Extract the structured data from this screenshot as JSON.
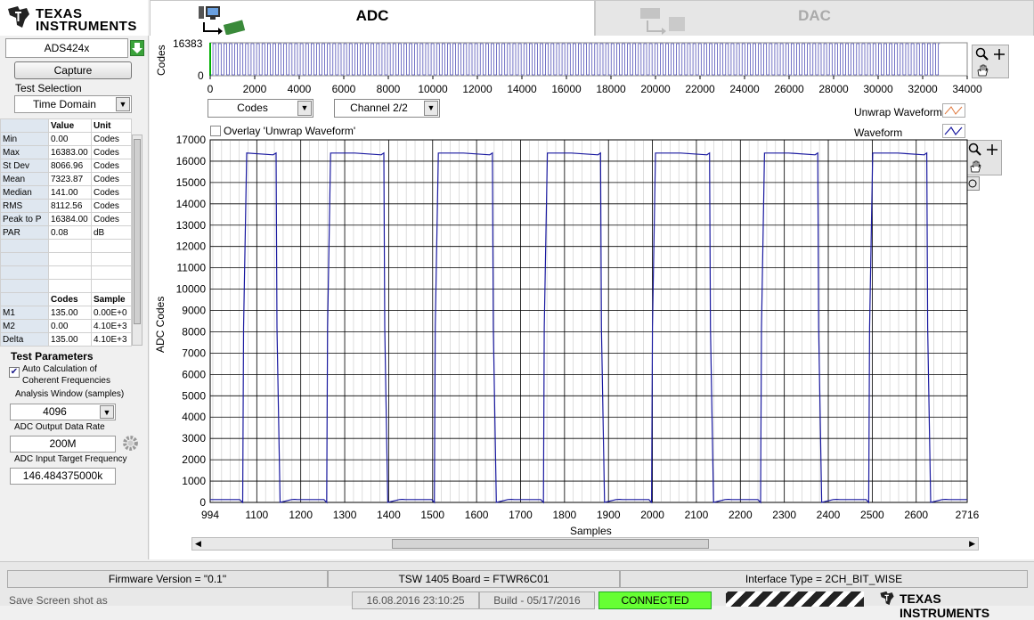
{
  "brand": {
    "line1": "Texas",
    "line2": "Instruments",
    "footer": "Texas Instruments"
  },
  "tabs": [
    {
      "label": "ADC"
    },
    {
      "label": "DAC"
    }
  ],
  "left": {
    "device": "ADS424x",
    "capture_label": "Capture",
    "test_selection_label": "Test Selection",
    "test_selection_value": "Time Domain",
    "stats_headers": [
      "Value",
      "Unit"
    ],
    "stats": [
      {
        "name": "Min",
        "value": "0.00",
        "unit": "Codes"
      },
      {
        "name": "Max",
        "value": "16383.00",
        "unit": "Codes"
      },
      {
        "name": "St Dev",
        "value": "8066.96",
        "unit": "Codes"
      },
      {
        "name": "Mean",
        "value": "7323.87",
        "unit": "Codes"
      },
      {
        "name": "Median",
        "value": "141.00",
        "unit": "Codes"
      },
      {
        "name": "RMS",
        "value": "8112.56",
        "unit": "Codes"
      },
      {
        "name": "Peak to P",
        "value": "16384.00",
        "unit": "Codes"
      },
      {
        "name": "PAR",
        "value": "0.08",
        "unit": "dB"
      }
    ],
    "marker_headers": [
      "Codes",
      "Sample"
    ],
    "markers": [
      {
        "name": "M1",
        "codes": "135.00",
        "sample": "0.00E+0"
      },
      {
        "name": "M2",
        "codes": "0.00",
        "sample": "4.10E+3"
      },
      {
        "name": "Delta",
        "codes": "135.00",
        "sample": "4.10E+3"
      }
    ],
    "test_params_title": "Test Parameters",
    "auto_calc_label1": "Auto Calculation of",
    "auto_calc_label2": "Coherent Frequencies",
    "auto_calc_checked": true,
    "analysis_window_label": "Analysis Window (samples)",
    "analysis_window_value": "4096",
    "data_rate_label": "ADC Output Data Rate",
    "data_rate_value": "200M",
    "target_freq_label": "ADC Input Target Frequency",
    "target_freq_value": "146.484375000k"
  },
  "overview": {
    "ylabel": "Codes",
    "ymax_label": "16383",
    "ymin_label": "0",
    "xticks": [
      "0",
      "2000",
      "4000",
      "6000",
      "8000",
      "10000",
      "12000",
      "14000",
      "16000",
      "18000",
      "20000",
      "22000",
      "24000",
      "26000",
      "28000",
      "30000",
      "32000",
      "34000"
    ]
  },
  "controls": {
    "units_value": "Codes",
    "channel_value": "Channel 2/2",
    "overlay_label": "Overlay 'Unwrap Waveform'",
    "legend_unwrap": "Unwrap Waveform",
    "legend_waveform": "Waveform"
  },
  "chart_data": {
    "type": "line",
    "xlabel": "Samples",
    "ylabel": "ADC Codes",
    "xlim": [
      994,
      2716
    ],
    "ylim": [
      0,
      17000
    ],
    "yticks": [
      "0",
      "1000",
      "2000",
      "3000",
      "4000",
      "5000",
      "6000",
      "7000",
      "8000",
      "9000",
      "10000",
      "11000",
      "12000",
      "13000",
      "14000",
      "15000",
      "16000",
      "17000"
    ],
    "xticks": [
      "994",
      "1100",
      "1200",
      "1300",
      "1400",
      "1500",
      "1600",
      "1700",
      "1800",
      "1900",
      "2000",
      "2100",
      "2200",
      "2300",
      "2400",
      "2500",
      "2600",
      "2716"
    ],
    "series": [
      {
        "color": "#1a1aa0",
        "x": [
          994,
          1061,
          1068,
          1070,
          1077,
          1137,
          1144,
          1146,
          1153,
          1179,
          1185,
          1187,
          1193,
          1253,
          1259,
          1261,
          1268,
          1308,
          1315,
          1317,
          1323,
          1383,
          1389,
          1391,
          1398,
          1424,
          1430,
          1432,
          1438,
          1498,
          1504,
          1506,
          1513,
          1555,
          1562,
          1564,
          1570,
          1630,
          1636,
          1638,
          1645,
          1671,
          1678,
          1680,
          1686,
          1746,
          1752,
          1754,
          1761,
          1801,
          1808,
          1810,
          1816,
          1876,
          1882,
          1884,
          1891,
          1917,
          1924,
          1926,
          1932,
          1992,
          1998,
          2000,
          2007,
          2049,
          2056,
          2058,
          2064,
          2124,
          2130,
          2132,
          2139,
          2165,
          2172,
          2174,
          2180,
          2240,
          2246,
          2248,
          2255,
          2295,
          2302,
          2304,
          2310,
          2370,
          2376,
          2378,
          2385,
          2411,
          2418,
          2420,
          2426,
          2486,
          2492,
          2494,
          2501,
          2543,
          2550,
          2552,
          2558,
          2618,
          2624,
          2626,
          2633,
          2659,
          2666,
          2668,
          2674,
          2716
        ],
        "y": [
          135,
          135,
          0,
          8192,
          16383,
          16300,
          16383,
          8192,
          0,
          135,
          141,
          141,
          135,
          135,
          0,
          8192,
          16383,
          16383,
          16383,
          16383,
          16383,
          16300,
          16383,
          8192,
          0,
          135,
          141,
          141,
          135,
          135,
          0,
          8192,
          16383,
          16383,
          16383,
          16383,
          16383,
          16300,
          16383,
          8192,
          0,
          135,
          141,
          141,
          135,
          135,
          0,
          8192,
          16383,
          16383,
          16383,
          16383,
          16383,
          16300,
          16383,
          8192,
          0,
          135,
          141,
          141,
          135,
          135,
          0,
          8192,
          16383,
          16383,
          16383,
          16383,
          16383,
          16300,
          16383,
          8192,
          0,
          135,
          141,
          141,
          135,
          135,
          0,
          8192,
          16383,
          16383,
          16383,
          16383,
          16383,
          16300,
          16383,
          8192,
          0,
          135,
          141,
          141,
          135,
          135,
          0,
          8192,
          16383,
          16383,
          16383,
          16383,
          16383,
          16300,
          16383,
          8192,
          0,
          135,
          141,
          141,
          135,
          135
        ]
      }
    ],
    "grid": true
  },
  "status": {
    "firmware": "Firmware Version = \"0.1\"",
    "board": "TSW 1405 Board = FTWR6C01",
    "interface": "Interface Type = 2CH_BIT_WISE",
    "save_label": "Save Screen shot as",
    "datetime": "16.08.2016 23:10:25",
    "build": "Build  - 05/17/2016",
    "connection": "CONNECTED",
    "connection_color": "#66ff33"
  }
}
